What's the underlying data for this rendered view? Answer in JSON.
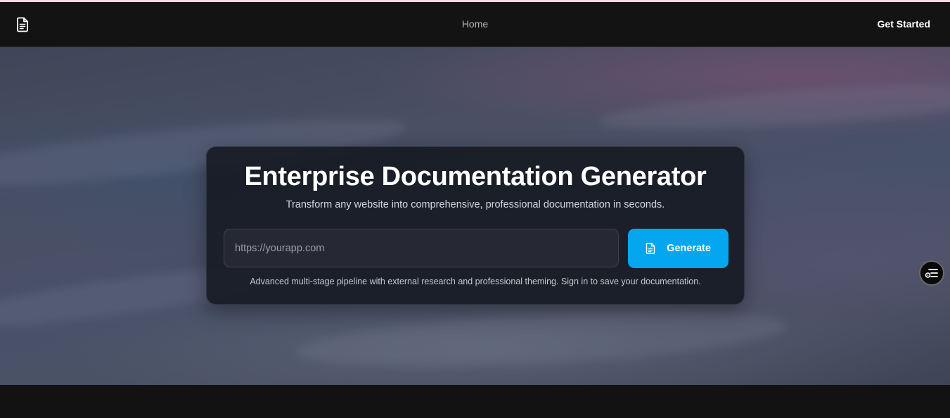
{
  "nav": {
    "home_label": "Home",
    "cta_label": "Get Started",
    "logo_icon": "document-icon"
  },
  "hero": {
    "title": "Enterprise Documentation Generator",
    "subtitle": "Transform any website into comprehensive, professional documentation in seconds.",
    "url_input": {
      "value": "",
      "placeholder": "https://yourapp.com"
    },
    "generate_button": {
      "label": "Generate",
      "icon": "document-icon"
    },
    "note": "Advanced multi-stage pipeline with external research and professional theming. Sign in to save your documentation."
  },
  "floating_button": {
    "icon": "settings-list-icon"
  },
  "colors": {
    "accent": "#05a6f0",
    "navbar_bg": "#131313",
    "card_bg": "#14181f",
    "top_strip": "#f7d9e3"
  }
}
